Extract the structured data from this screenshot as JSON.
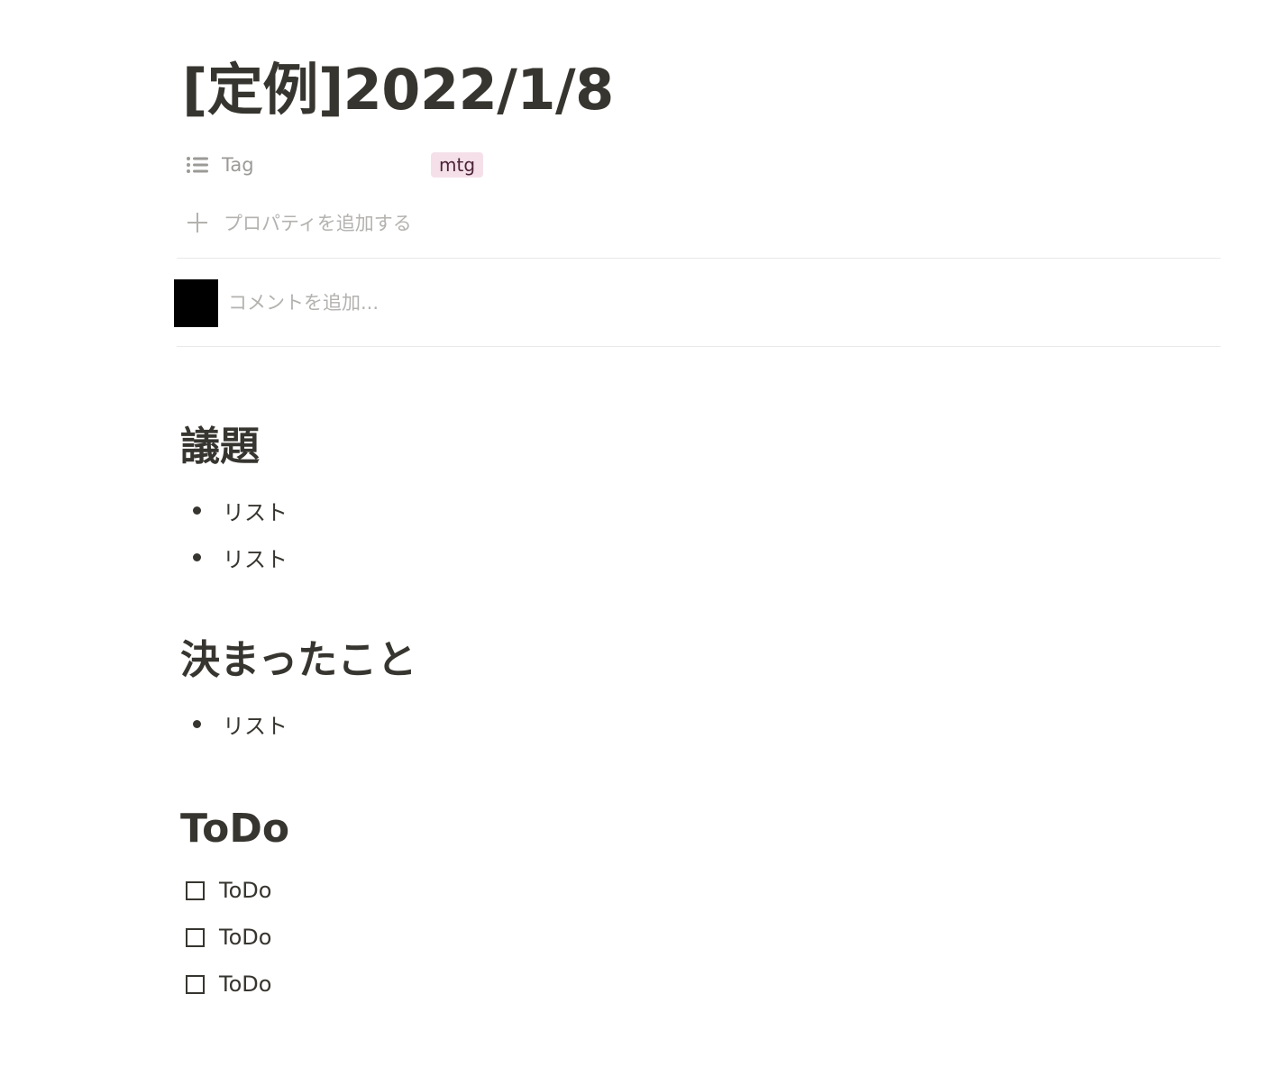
{
  "page": {
    "title": "[定例]2022/1/8"
  },
  "properties": [
    {
      "name": "Tag",
      "icon": "list-icon",
      "value": "mtg",
      "value_color": "#f5e0e9"
    }
  ],
  "add_property_label": "プロパティを追加する",
  "comment": {
    "placeholder": "コメントを追加..."
  },
  "sections": {
    "agenda": {
      "heading": "議題",
      "items": [
        "リスト",
        "リスト"
      ]
    },
    "decisions": {
      "heading": "決まったこと",
      "items": [
        "リスト"
      ]
    },
    "todo": {
      "heading": "ToDo",
      "items": [
        {
          "label": "ToDo",
          "checked": false
        },
        {
          "label": "ToDo",
          "checked": false
        },
        {
          "label": "ToDo",
          "checked": false
        }
      ]
    }
  }
}
